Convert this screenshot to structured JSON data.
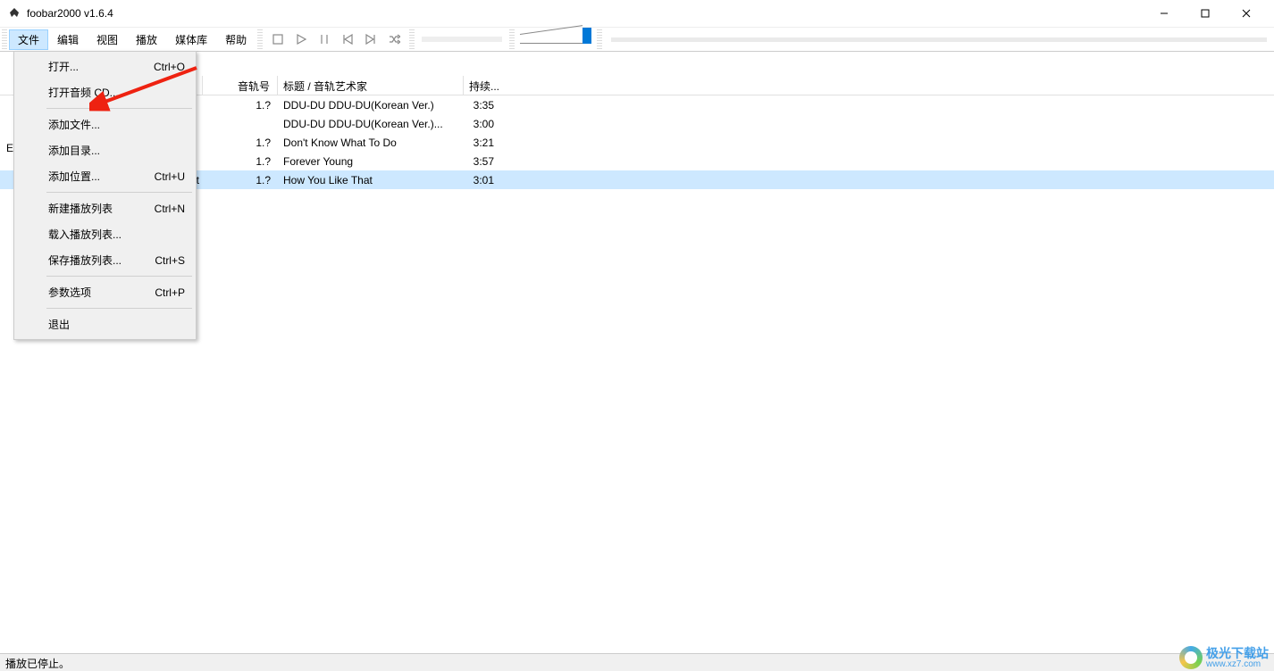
{
  "window": {
    "title": "foobar2000 v1.6.4"
  },
  "menu": {
    "items": [
      "文件",
      "编辑",
      "视图",
      "播放",
      "媒体库",
      "帮助"
    ],
    "active_index": 0
  },
  "dropdown": {
    "groups": [
      [
        {
          "label": "打开...",
          "shortcut": "Ctrl+O"
        },
        {
          "label": "打开音频 CD...",
          "shortcut": ""
        }
      ],
      [
        {
          "label": "添加文件...",
          "shortcut": ""
        },
        {
          "label": "添加目录...",
          "shortcut": ""
        },
        {
          "label": "添加位置...",
          "shortcut": "Ctrl+U"
        }
      ],
      [
        {
          "label": "新建播放列表",
          "shortcut": "Ctrl+N"
        },
        {
          "label": "载入播放列表...",
          "shortcut": ""
        },
        {
          "label": "保存播放列表...",
          "shortcut": "Ctrl+S"
        }
      ],
      [
        {
          "label": "参数选项",
          "shortcut": "Ctrl+P"
        }
      ],
      [
        {
          "label": "退出",
          "shortcut": ""
        }
      ]
    ]
  },
  "columns": {
    "track": "音轨号",
    "title": "标题 / 音轨艺术家",
    "duration": "持续..."
  },
  "playlist": [
    {
      "state": "",
      "track": "1.?",
      "title": "DDU-DU DDU-DU(Korean Ver.)",
      "duration": "3:35",
      "selected": false
    },
    {
      "state": "",
      "track": "",
      "title": "DDU-DU DDU-DU(Korean Ver.)...",
      "duration": "3:00",
      "selected": false
    },
    {
      "state": "",
      "track": "1.?",
      "title": "Don't Know What To Do",
      "duration": "3:21",
      "selected": false
    },
    {
      "state": "",
      "track": "1.?",
      "title": "Forever Young",
      "duration": "3:57",
      "selected": false
    },
    {
      "state": "That",
      "track": "1.?",
      "title": "How You Like That",
      "duration": "3:01",
      "selected": true
    }
  ],
  "status": {
    "text": "播放已停止。"
  },
  "watermark": {
    "brand": "极光下载站",
    "url": "www.xz7.com"
  },
  "left_partial": {
    "text": "E"
  }
}
